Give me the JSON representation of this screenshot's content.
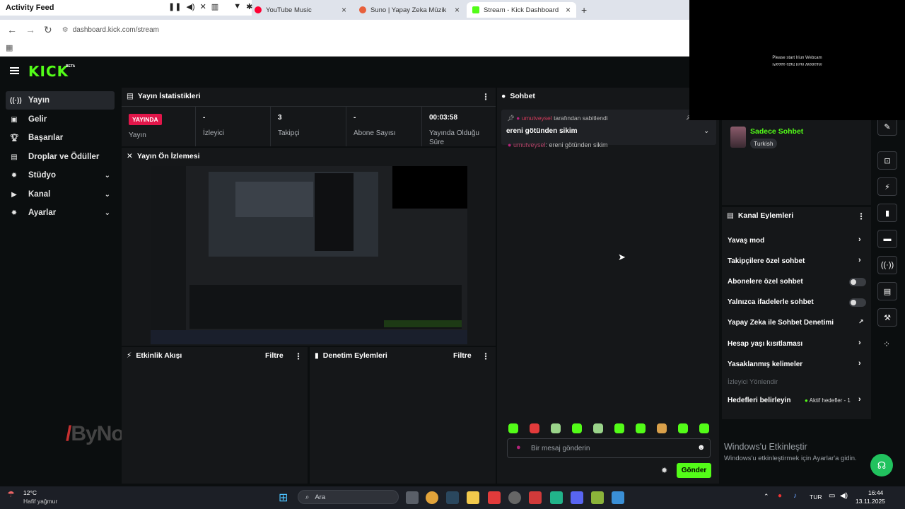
{
  "browser": {
    "activity_feed_title": "Activity Feed",
    "tabs": [
      {
        "label": "YouTube Music",
        "color": "#ff0033"
      },
      {
        "label": "Suno | Yapay Zeka Müzik",
        "color": "#e8603c"
      },
      {
        "label": "Stream - Kick Dashboard",
        "color": "#53fc18"
      }
    ],
    "url": "dashboard.kick.com/stream"
  },
  "webcam_overlay": {
    "line1": "Please start Iriun Webcam",
    "line2": "Please start Iriun Webcam"
  },
  "header": {
    "logo": "KICK",
    "beta": "BETA"
  },
  "sidebar": {
    "items": [
      {
        "label": "Yayın",
        "icon": "broadcast-icon"
      },
      {
        "label": "Gelir",
        "icon": "money-icon"
      },
      {
        "label": "Başarılar",
        "icon": "trophy-icon"
      },
      {
        "label": "Droplar ve Ödüller",
        "icon": "gift-icon"
      },
      {
        "label": "Stüdyo",
        "icon": "gear-icon"
      },
      {
        "label": "Kanal",
        "icon": "video-icon"
      },
      {
        "label": "Ayarlar",
        "icon": "gear-icon"
      }
    ]
  },
  "stats": {
    "title": "Yayın İstatistikleri",
    "live_badge": "YAYINDA",
    "live_label": "Yayın",
    "viewers_value": "-",
    "viewers_label": "İzleyici",
    "followers_value": "3",
    "followers_label": "Takipçi",
    "subs_value": "-",
    "subs_label": "Abone Sayısı",
    "uptime_value": "00:03:58",
    "uptime_label": "Yayında Olduğu Süre"
  },
  "preview": {
    "title": "Yayın Ön İzlemesi"
  },
  "activity": {
    "title": "Etkinlik Akışı",
    "filter": "Filtre"
  },
  "moderation": {
    "title": "Denetim Eylemleri",
    "filter": "Filtre"
  },
  "chat": {
    "title": "Sohbet",
    "pinned_user": "umutveysel",
    "pinned_by": "tarafından sabitlendi",
    "pinned_message": "ereni götünden sikim",
    "message_user": "umutveysel",
    "message_text": ": ereni götünden sikim",
    "input_placeholder": "Bir mesaj gönderin",
    "send_label": "Gönder"
  },
  "profile": {
    "name": "Sadece Sohbet",
    "language": "Turkish"
  },
  "channel_actions": {
    "title": "Kanal Eylemleri",
    "slow_mode": "Yavaş mod",
    "followers_only": "Takipçilere özel sohbet",
    "subs_only": "Abonelere özel sohbet",
    "emotes_only": "Yalnızca ifadelerle sohbet",
    "ai_moderation": "Yapay Zeka ile Sohbet Denetimi",
    "account_age": "Hesap yaşı kısıtlaması",
    "banned_words": "Yasaklanmış kelimeler",
    "viewer_redirect": "İzleyici Yönlendir",
    "set_goals": "Hedefleri belirleyin",
    "active_goals": "Aktif hedefler - 1"
  },
  "watermark": {
    "line1": "Windows'u Etkinleştir",
    "line2": "Windows'u etkinleştirmek için Ayarlar'a gidin."
  },
  "brand_watermark": "ByNoGame",
  "taskbar": {
    "temp": "12°C",
    "weather": "Hafif yağmur",
    "search": "Ara",
    "lang": "TUR",
    "time": "16:44",
    "date": "13.11.2025"
  }
}
